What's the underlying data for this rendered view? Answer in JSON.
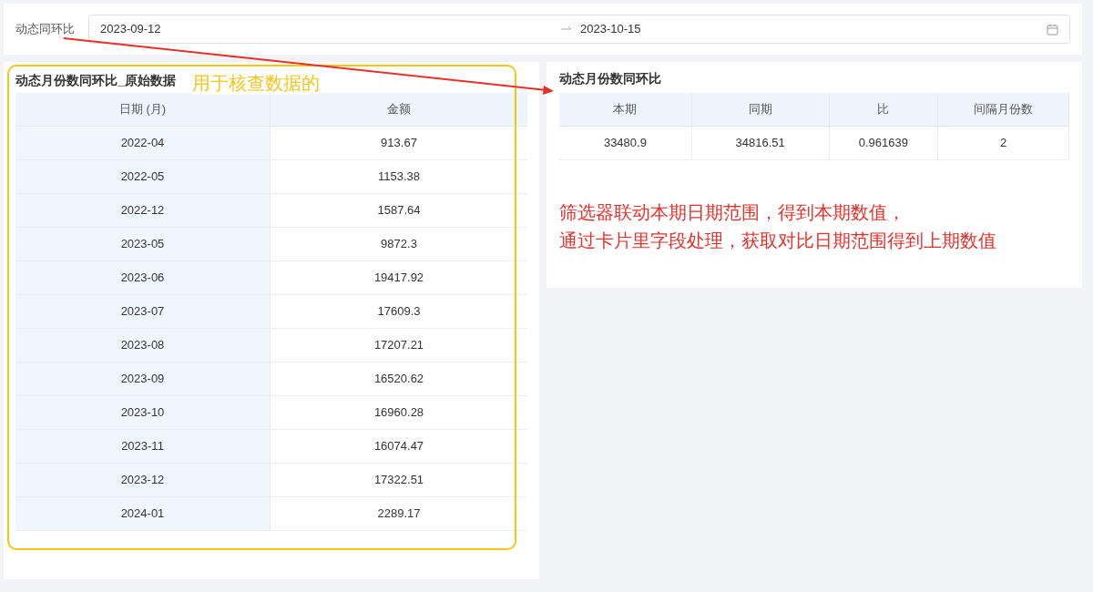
{
  "filter": {
    "label": "动态同环比",
    "start_date": "2023-09-12",
    "end_date": "2023-10-15"
  },
  "raw_table": {
    "title": "动态月份数同环比_原始数据",
    "columns": [
      "日期 (月)",
      "金额"
    ],
    "rows": [
      [
        "2022-04",
        "913.67"
      ],
      [
        "2022-05",
        "1153.38"
      ],
      [
        "2022-12",
        "1587.64"
      ],
      [
        "2023-05",
        "9872.3"
      ],
      [
        "2023-06",
        "19417.92"
      ],
      [
        "2023-07",
        "17609.3"
      ],
      [
        "2023-08",
        "17207.21"
      ],
      [
        "2023-09",
        "16520.62"
      ],
      [
        "2023-10",
        "16960.28"
      ],
      [
        "2023-11",
        "16074.47"
      ],
      [
        "2023-12",
        "17322.51"
      ],
      [
        "2024-01",
        "2289.17"
      ]
    ]
  },
  "summary_table": {
    "title": "动态月份数同环比",
    "columns": [
      "本期",
      "同期",
      "比",
      "间隔月份数"
    ],
    "rows": [
      [
        "33480.9",
        "34816.51",
        "0.961639",
        "2"
      ]
    ]
  },
  "annotations": {
    "raw_note": "用于核查数据的",
    "explanation": [
      "筛选器联动本期日期范围，得到本期数值，",
      "通过卡片里字段处理，获取对比日期范围得到上期数值"
    ]
  }
}
